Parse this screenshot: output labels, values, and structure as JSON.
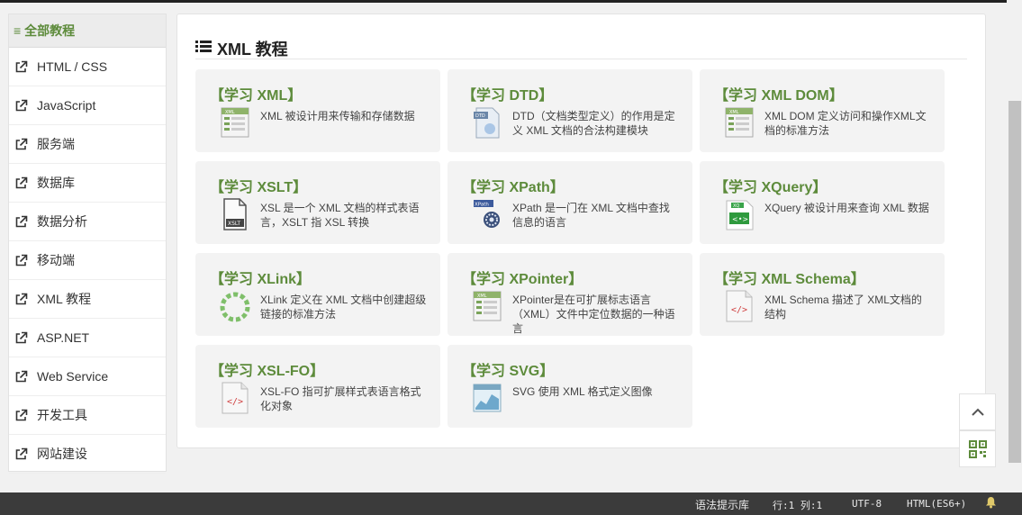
{
  "sidebar": {
    "header": "全部教程",
    "items": [
      {
        "label": "HTML / CSS"
      },
      {
        "label": "JavaScript"
      },
      {
        "label": "服务端"
      },
      {
        "label": "数据库"
      },
      {
        "label": "数据分析"
      },
      {
        "label": "移动端"
      },
      {
        "label": "XML 教程"
      },
      {
        "label": "ASP.NET"
      },
      {
        "label": "Web Service"
      },
      {
        "label": "开发工具"
      },
      {
        "label": "网站建设"
      }
    ]
  },
  "main": {
    "title": "XML 教程",
    "cards": [
      {
        "title": "【学习 XML】",
        "desc": "XML 被设计用来传输和存储数据",
        "icon": "xml-file-icon"
      },
      {
        "title": "【学习 DTD】",
        "desc": "DTD（文档类型定义）的作用是定义 XML 文档的合法构建模块",
        "icon": "dtd-file-icon"
      },
      {
        "title": "【学习 XML DOM】",
        "desc": "XML DOM 定义访问和操作XML文档的标准方法",
        "icon": "xml-dom-icon"
      },
      {
        "title": "【学习 XSLT】",
        "desc": "XSL 是一个 XML 文档的样式表语言，XSLT 指 XSL 转换",
        "icon": "xslt-file-icon"
      },
      {
        "title": "【学习 XPath】",
        "desc": "XPath 是一门在 XML 文档中查找信息的语言",
        "icon": "xpath-gear-icon"
      },
      {
        "title": "【学习 XQuery】",
        "desc": "XQuery 被设计用来查询 XML 数据",
        "icon": "xquery-icon"
      },
      {
        "title": "【学习 XLink】",
        "desc": "XLink 定义在 XML 文档中创建超级链接的标准方法",
        "icon": "xlink-ring-icon"
      },
      {
        "title": "【学习 XPointer】",
        "desc": "XPointer是在可扩展标志语言（XML）文件中定位数据的一种语言",
        "icon": "xpointer-file-icon"
      },
      {
        "title": "【学习 XML Schema】",
        "desc": "XML Schema 描述了 XML文档的结构",
        "icon": "xml-schema-icon"
      },
      {
        "title": "【学习 XSL-FO】",
        "desc": "XSL-FO 指可扩展样式表语言格式化对象",
        "icon": "xsl-fo-icon"
      },
      {
        "title": "【学习 SVG】",
        "desc": "SVG 使用 XML 格式定义图像",
        "icon": "svg-chart-icon"
      }
    ]
  },
  "statusbar": {
    "syntax_hint": "语法提示库",
    "position": "行:1  列:1",
    "encoding": "UTF-8",
    "language": "HTML(ES6+)"
  },
  "colors": {
    "accent_green": "#5d8b3b",
    "status_bg": "#3b3b3b"
  }
}
